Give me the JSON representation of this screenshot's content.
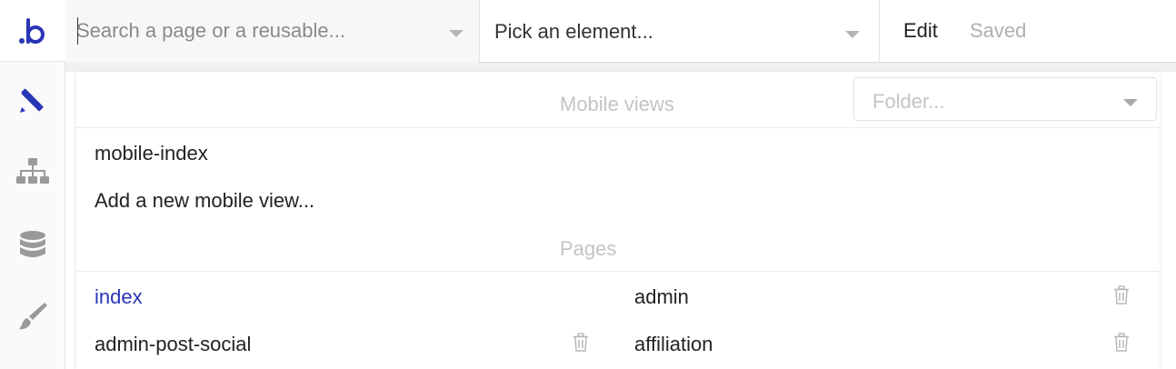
{
  "app": {
    "logo_text": ".b",
    "brand_color": "#2a35b6",
    "rail_icons": [
      "design-pencil-ruler-icon",
      "sitemap-icon",
      "database-icon",
      "paintbrush-icon"
    ]
  },
  "topbar": {
    "search_placeholder": "Search a page or a reusable...",
    "search_value": "",
    "element_picker_label": "Pick an element...",
    "edit_label": "Edit",
    "saved_label": "Saved"
  },
  "dropdown": {
    "folder_placeholder": "Folder...",
    "mobile_views_title": "Mobile views",
    "mobile_views": [
      "mobile-index"
    ],
    "add_mobile_view_label": "Add a new mobile view...",
    "pages_title": "Pages",
    "pages": [
      {
        "name": "index",
        "selected": true,
        "deletable": false
      },
      {
        "name": "admin",
        "selected": false,
        "deletable": true
      },
      {
        "name": "admin-post-social",
        "selected": false,
        "deletable": true
      },
      {
        "name": "affiliation",
        "selected": false,
        "deletable": true
      }
    ]
  }
}
